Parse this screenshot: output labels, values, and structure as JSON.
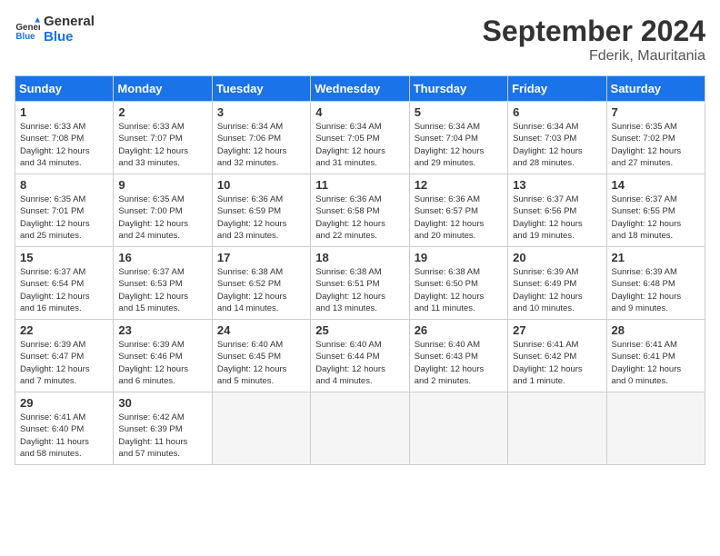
{
  "header": {
    "logo_line1": "General",
    "logo_line2": "Blue",
    "month": "September 2024",
    "location": "Fderik, Mauritania"
  },
  "weekdays": [
    "Sunday",
    "Monday",
    "Tuesday",
    "Wednesday",
    "Thursday",
    "Friday",
    "Saturday"
  ],
  "weeks": [
    [
      {
        "day": "1",
        "sunrise": "6:33 AM",
        "sunset": "7:08 PM",
        "daylight": "12 hours and 34 minutes."
      },
      {
        "day": "2",
        "sunrise": "6:33 AM",
        "sunset": "7:07 PM",
        "daylight": "12 hours and 33 minutes."
      },
      {
        "day": "3",
        "sunrise": "6:34 AM",
        "sunset": "7:06 PM",
        "daylight": "12 hours and 32 minutes."
      },
      {
        "day": "4",
        "sunrise": "6:34 AM",
        "sunset": "7:05 PM",
        "daylight": "12 hours and 31 minutes."
      },
      {
        "day": "5",
        "sunrise": "6:34 AM",
        "sunset": "7:04 PM",
        "daylight": "12 hours and 29 minutes."
      },
      {
        "day": "6",
        "sunrise": "6:34 AM",
        "sunset": "7:03 PM",
        "daylight": "12 hours and 28 minutes."
      },
      {
        "day": "7",
        "sunrise": "6:35 AM",
        "sunset": "7:02 PM",
        "daylight": "12 hours and 27 minutes."
      }
    ],
    [
      {
        "day": "8",
        "sunrise": "6:35 AM",
        "sunset": "7:01 PM",
        "daylight": "12 hours and 25 minutes."
      },
      {
        "day": "9",
        "sunrise": "6:35 AM",
        "sunset": "7:00 PM",
        "daylight": "12 hours and 24 minutes."
      },
      {
        "day": "10",
        "sunrise": "6:36 AM",
        "sunset": "6:59 PM",
        "daylight": "12 hours and 23 minutes."
      },
      {
        "day": "11",
        "sunrise": "6:36 AM",
        "sunset": "6:58 PM",
        "daylight": "12 hours and 22 minutes."
      },
      {
        "day": "12",
        "sunrise": "6:36 AM",
        "sunset": "6:57 PM",
        "daylight": "12 hours and 20 minutes."
      },
      {
        "day": "13",
        "sunrise": "6:37 AM",
        "sunset": "6:56 PM",
        "daylight": "12 hours and 19 minutes."
      },
      {
        "day": "14",
        "sunrise": "6:37 AM",
        "sunset": "6:55 PM",
        "daylight": "12 hours and 18 minutes."
      }
    ],
    [
      {
        "day": "15",
        "sunrise": "6:37 AM",
        "sunset": "6:54 PM",
        "daylight": "12 hours and 16 minutes."
      },
      {
        "day": "16",
        "sunrise": "6:37 AM",
        "sunset": "6:53 PM",
        "daylight": "12 hours and 15 minutes."
      },
      {
        "day": "17",
        "sunrise": "6:38 AM",
        "sunset": "6:52 PM",
        "daylight": "12 hours and 14 minutes."
      },
      {
        "day": "18",
        "sunrise": "6:38 AM",
        "sunset": "6:51 PM",
        "daylight": "12 hours and 13 minutes."
      },
      {
        "day": "19",
        "sunrise": "6:38 AM",
        "sunset": "6:50 PM",
        "daylight": "12 hours and 11 minutes."
      },
      {
        "day": "20",
        "sunrise": "6:39 AM",
        "sunset": "6:49 PM",
        "daylight": "12 hours and 10 minutes."
      },
      {
        "day": "21",
        "sunrise": "6:39 AM",
        "sunset": "6:48 PM",
        "daylight": "12 hours and 9 minutes."
      }
    ],
    [
      {
        "day": "22",
        "sunrise": "6:39 AM",
        "sunset": "6:47 PM",
        "daylight": "12 hours and 7 minutes."
      },
      {
        "day": "23",
        "sunrise": "6:39 AM",
        "sunset": "6:46 PM",
        "daylight": "12 hours and 6 minutes."
      },
      {
        "day": "24",
        "sunrise": "6:40 AM",
        "sunset": "6:45 PM",
        "daylight": "12 hours and 5 minutes."
      },
      {
        "day": "25",
        "sunrise": "6:40 AM",
        "sunset": "6:44 PM",
        "daylight": "12 hours and 4 minutes."
      },
      {
        "day": "26",
        "sunrise": "6:40 AM",
        "sunset": "6:43 PM",
        "daylight": "12 hours and 2 minutes."
      },
      {
        "day": "27",
        "sunrise": "6:41 AM",
        "sunset": "6:42 PM",
        "daylight": "12 hours and 1 minute."
      },
      {
        "day": "28",
        "sunrise": "6:41 AM",
        "sunset": "6:41 PM",
        "daylight": "12 hours and 0 minutes."
      }
    ],
    [
      {
        "day": "29",
        "sunrise": "6:41 AM",
        "sunset": "6:40 PM",
        "daylight": "11 hours and 58 minutes."
      },
      {
        "day": "30",
        "sunrise": "6:42 AM",
        "sunset": "6:39 PM",
        "daylight": "11 hours and 57 minutes."
      },
      null,
      null,
      null,
      null,
      null
    ]
  ]
}
